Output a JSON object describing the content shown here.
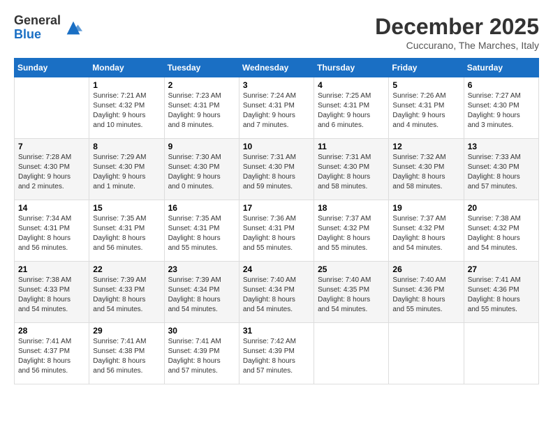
{
  "logo": {
    "general": "General",
    "blue": "Blue"
  },
  "title": {
    "month": "December 2025",
    "location": "Cuccurano, The Marches, Italy"
  },
  "days_header": [
    "Sunday",
    "Monday",
    "Tuesday",
    "Wednesday",
    "Thursday",
    "Friday",
    "Saturday"
  ],
  "weeks": [
    [
      {
        "num": "",
        "info": ""
      },
      {
        "num": "1",
        "info": "Sunrise: 7:21 AM\nSunset: 4:32 PM\nDaylight: 9 hours\nand 10 minutes."
      },
      {
        "num": "2",
        "info": "Sunrise: 7:23 AM\nSunset: 4:31 PM\nDaylight: 9 hours\nand 8 minutes."
      },
      {
        "num": "3",
        "info": "Sunrise: 7:24 AM\nSunset: 4:31 PM\nDaylight: 9 hours\nand 7 minutes."
      },
      {
        "num": "4",
        "info": "Sunrise: 7:25 AM\nSunset: 4:31 PM\nDaylight: 9 hours\nand 6 minutes."
      },
      {
        "num": "5",
        "info": "Sunrise: 7:26 AM\nSunset: 4:31 PM\nDaylight: 9 hours\nand 4 minutes."
      },
      {
        "num": "6",
        "info": "Sunrise: 7:27 AM\nSunset: 4:30 PM\nDaylight: 9 hours\nand 3 minutes."
      }
    ],
    [
      {
        "num": "7",
        "info": "Sunrise: 7:28 AM\nSunset: 4:30 PM\nDaylight: 9 hours\nand 2 minutes."
      },
      {
        "num": "8",
        "info": "Sunrise: 7:29 AM\nSunset: 4:30 PM\nDaylight: 9 hours\nand 1 minute."
      },
      {
        "num": "9",
        "info": "Sunrise: 7:30 AM\nSunset: 4:30 PM\nDaylight: 9 hours\nand 0 minutes."
      },
      {
        "num": "10",
        "info": "Sunrise: 7:31 AM\nSunset: 4:30 PM\nDaylight: 8 hours\nand 59 minutes."
      },
      {
        "num": "11",
        "info": "Sunrise: 7:31 AM\nSunset: 4:30 PM\nDaylight: 8 hours\nand 58 minutes."
      },
      {
        "num": "12",
        "info": "Sunrise: 7:32 AM\nSunset: 4:30 PM\nDaylight: 8 hours\nand 58 minutes."
      },
      {
        "num": "13",
        "info": "Sunrise: 7:33 AM\nSunset: 4:30 PM\nDaylight: 8 hours\nand 57 minutes."
      }
    ],
    [
      {
        "num": "14",
        "info": "Sunrise: 7:34 AM\nSunset: 4:31 PM\nDaylight: 8 hours\nand 56 minutes."
      },
      {
        "num": "15",
        "info": "Sunrise: 7:35 AM\nSunset: 4:31 PM\nDaylight: 8 hours\nand 56 minutes."
      },
      {
        "num": "16",
        "info": "Sunrise: 7:35 AM\nSunset: 4:31 PM\nDaylight: 8 hours\nand 55 minutes."
      },
      {
        "num": "17",
        "info": "Sunrise: 7:36 AM\nSunset: 4:31 PM\nDaylight: 8 hours\nand 55 minutes."
      },
      {
        "num": "18",
        "info": "Sunrise: 7:37 AM\nSunset: 4:32 PM\nDaylight: 8 hours\nand 55 minutes."
      },
      {
        "num": "19",
        "info": "Sunrise: 7:37 AM\nSunset: 4:32 PM\nDaylight: 8 hours\nand 54 minutes."
      },
      {
        "num": "20",
        "info": "Sunrise: 7:38 AM\nSunset: 4:32 PM\nDaylight: 8 hours\nand 54 minutes."
      }
    ],
    [
      {
        "num": "21",
        "info": "Sunrise: 7:38 AM\nSunset: 4:33 PM\nDaylight: 8 hours\nand 54 minutes."
      },
      {
        "num": "22",
        "info": "Sunrise: 7:39 AM\nSunset: 4:33 PM\nDaylight: 8 hours\nand 54 minutes."
      },
      {
        "num": "23",
        "info": "Sunrise: 7:39 AM\nSunset: 4:34 PM\nDaylight: 8 hours\nand 54 minutes."
      },
      {
        "num": "24",
        "info": "Sunrise: 7:40 AM\nSunset: 4:34 PM\nDaylight: 8 hours\nand 54 minutes."
      },
      {
        "num": "25",
        "info": "Sunrise: 7:40 AM\nSunset: 4:35 PM\nDaylight: 8 hours\nand 54 minutes."
      },
      {
        "num": "26",
        "info": "Sunrise: 7:40 AM\nSunset: 4:36 PM\nDaylight: 8 hours\nand 55 minutes."
      },
      {
        "num": "27",
        "info": "Sunrise: 7:41 AM\nSunset: 4:36 PM\nDaylight: 8 hours\nand 55 minutes."
      }
    ],
    [
      {
        "num": "28",
        "info": "Sunrise: 7:41 AM\nSunset: 4:37 PM\nDaylight: 8 hours\nand 56 minutes."
      },
      {
        "num": "29",
        "info": "Sunrise: 7:41 AM\nSunset: 4:38 PM\nDaylight: 8 hours\nand 56 minutes."
      },
      {
        "num": "30",
        "info": "Sunrise: 7:41 AM\nSunset: 4:39 PM\nDaylight: 8 hours\nand 57 minutes."
      },
      {
        "num": "31",
        "info": "Sunrise: 7:42 AM\nSunset: 4:39 PM\nDaylight: 8 hours\nand 57 minutes."
      },
      {
        "num": "",
        "info": ""
      },
      {
        "num": "",
        "info": ""
      },
      {
        "num": "",
        "info": ""
      }
    ]
  ]
}
